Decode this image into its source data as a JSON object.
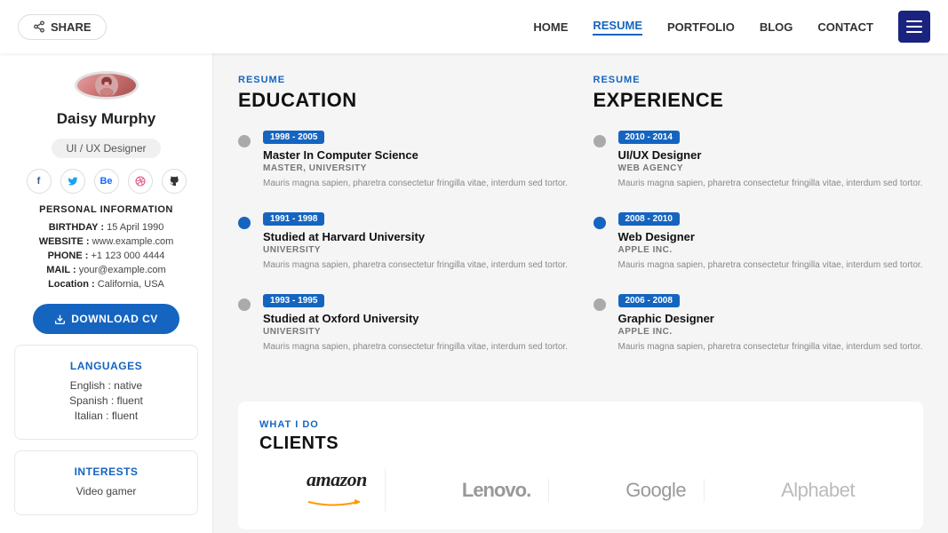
{
  "nav": {
    "share_label": "SHARE",
    "links": [
      "HOME",
      "RESUME",
      "PORTFOLIO",
      "BLOG",
      "CONTACT"
    ],
    "active": "RESUME"
  },
  "sidebar": {
    "name": "Daisy Murphy",
    "role": "UI / UX Designer",
    "social": [
      "f",
      "t",
      "Be",
      "⊕",
      "⌂"
    ],
    "personal_info_label": "PERSONAL INFORMATION",
    "birthday_label": "BIRTHDAY :",
    "birthday_value": "15 April 1990",
    "website_label": "WEBSITE :",
    "website_value": "www.example.com",
    "phone_label": "PHONE :",
    "phone_value": "+1 123 000 4444",
    "mail_label": "MAIL :",
    "mail_value": "your@example.com",
    "location_label": "Location :",
    "location_value": "California, USA",
    "download_label": "DOWNLOAD CV",
    "languages_title": "LANGUAGES",
    "languages": [
      "English : native",
      "Spanish : fluent",
      "Italian : fluent"
    ],
    "interests_title": "INTERESTS",
    "interests": [
      "Video gamer"
    ]
  },
  "education": {
    "tag": "RESUME",
    "title": "EDUCATION",
    "items": [
      {
        "period": "1998 - 2005",
        "title": "Master In Computer Science",
        "subtitle": "MASTER, UNIVERSITY",
        "desc": "Mauris magna sapien, pharetra consectetur fringilla vitae, interdum sed tortor.",
        "active": false
      },
      {
        "period": "1991 - 1998",
        "title": "Studied at Harvard University",
        "subtitle": "UNIVERSITY",
        "desc": "Mauris magna sapien, pharetra consectetur fringilla vitae, interdum sed tortor.",
        "active": true
      },
      {
        "period": "1993 - 1995",
        "title": "Studied at Oxford University",
        "subtitle": "UNIVERSITY",
        "desc": "Mauris magna sapien, pharetra consectetur fringilla vitae, interdum sed tortor.",
        "active": false
      }
    ]
  },
  "experience": {
    "tag": "RESUME",
    "title": "EXPERIENCE",
    "items": [
      {
        "period": "2010 - 2014",
        "title": "UI/UX Designer",
        "subtitle": "Web Agency",
        "desc": "Mauris magna sapien, pharetra consectetur fringilla vitae, interdum sed tortor.",
        "active": false
      },
      {
        "period": "2008 - 2010",
        "title": "Web Designer",
        "subtitle": "Apple Inc.",
        "desc": "Mauris magna sapien, pharetra consectetur fringilla vitae, interdum sed tortor.",
        "active": true
      },
      {
        "period": "2006 - 2008",
        "title": "Graphic Designer",
        "subtitle": "Apple Inc.",
        "desc": "Mauris magna sapien, pharetra consectetur fringilla vitae, interdum sed tortor.",
        "active": false
      }
    ]
  },
  "clients": {
    "tag": "WHAT I DO",
    "title": "CLIENTS",
    "logos": [
      "amazon",
      "Lenovo.",
      "Google",
      "Alphabet"
    ]
  }
}
